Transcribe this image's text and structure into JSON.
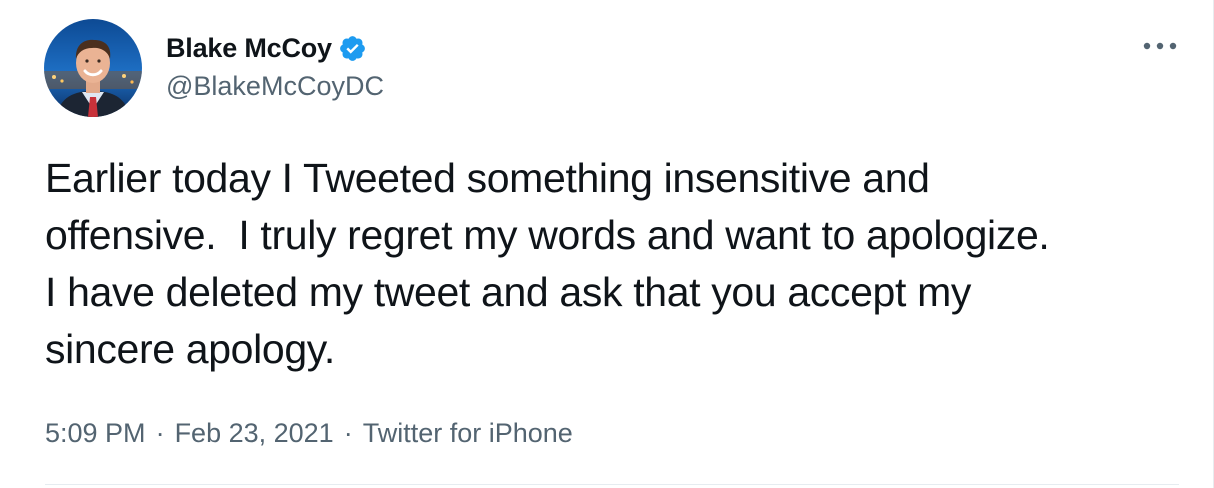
{
  "author": {
    "display_name": "Blake McCoy",
    "handle": "@BlakeMcCoyDC",
    "verified": true,
    "avatar_icon": "profile-photo"
  },
  "tweet": {
    "text": "Earlier today I Tweeted something insensitive and\noffensive.  I truly regret my words and want to apologize.\nI have deleted my tweet and ask that you accept my\nsincere apology.",
    "time": "5:09 PM",
    "date": "Feb 23, 2021",
    "source": "Twitter for iPhone",
    "separator": "·"
  },
  "icons": {
    "verified_badge": "verified-badge-icon",
    "more": "more-options-icon"
  },
  "colors": {
    "text_primary": "#0f1419",
    "text_secondary": "#536471",
    "verified_blue": "#1d9bf0"
  }
}
